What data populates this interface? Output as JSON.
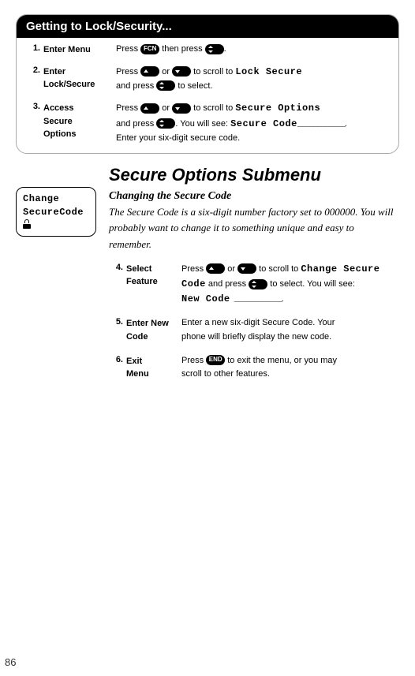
{
  "card": {
    "title": "Getting to Lock/Security...",
    "steps": [
      {
        "num": "1.",
        "label": "Enter Menu",
        "text_a": "Press ",
        "pill1": "FCN",
        "text_b": " then press ",
        "text_c": "."
      },
      {
        "num": "2.",
        "label_a": "Enter",
        "label_b": "Lock/Secure",
        "text_a": "Press ",
        "text_b": " or ",
        "text_c": " to scroll to ",
        "lcd1": "Lock Secure",
        "line2_a": "and press ",
        "line2_b": " to select."
      },
      {
        "num": "3.",
        "label_a": "Access",
        "label_b": "Secure",
        "label_c": "Options",
        "text_a": "Press ",
        "text_b": " or ",
        "text_c": " to scroll to ",
        "lcd1": "Secure Options",
        "line2_a": "and press ",
        "line2_b": ". You will see: ",
        "lcd2": "Secure Code",
        "dots": "____________",
        "line2_c": ".",
        "line3": "Enter your six-digit secure code."
      }
    ]
  },
  "screen_box": {
    "line1": "Change",
    "line2": "SecureCode"
  },
  "section_title": "Secure Options Submenu",
  "subheading": "Changing the Secure Code",
  "paragraph": "The Secure Code is a six-digit number factory set to 000000. You will probably want to change it to something unique and easy to remember.",
  "steps2": [
    {
      "num": "4.",
      "label_a": "Select",
      "label_b": "Feature",
      "text_a": "Press ",
      "text_b": " or ",
      "text_c": " to scroll to ",
      "lcd1": "Change Secure",
      "line2_lcd": "Code",
      "line2_a": " and press ",
      "line2_b": " to select. You will see:",
      "line3_lcd": "New Code",
      "dots": " ____________",
      "line3_b": "."
    },
    {
      "num": "5.",
      "label_a": "Enter New",
      "label_b": "Code",
      "line1": "Enter a new six-digit Secure Code. Your",
      "line2": "phone will briefly display the new code."
    },
    {
      "num": "6.",
      "label_a": "Exit",
      "label_b": "Menu",
      "text_a": "Press ",
      "pill": "END",
      "text_b": " to exit the menu, or you may",
      "line2": "scroll to other features."
    }
  ],
  "page_number": "86"
}
